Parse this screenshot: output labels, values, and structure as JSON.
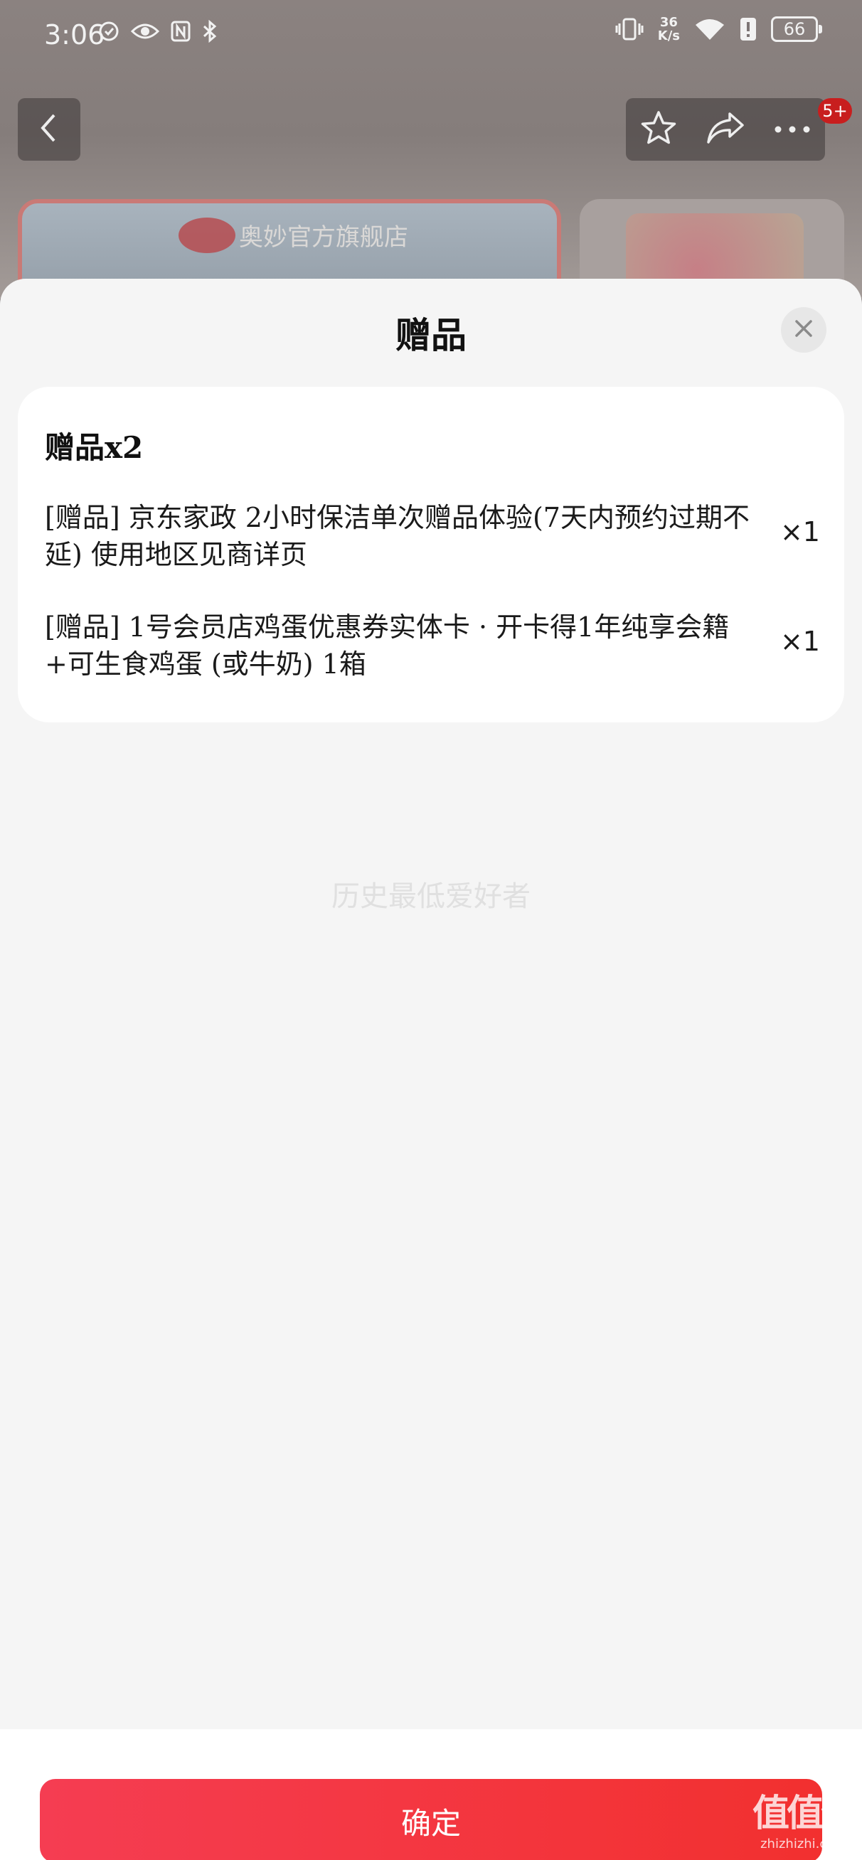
{
  "status_bar": {
    "time": "3:06",
    "net_speed_value": "36",
    "net_speed_unit": "K/s",
    "battery": "66"
  },
  "nav": {
    "cart_badge": "5+"
  },
  "background_banner": {
    "store_name": "奥妙官方旗舰店"
  },
  "sheet": {
    "title": "赠品",
    "gift_heading": "赠品x2",
    "items": [
      {
        "name": "[赠品] 京东家政 2小时保洁单次赠品体验(7天内预约过期不延) 使用地区见商详页",
        "qty": "×1"
      },
      {
        "name": "[赠品] 1号会员店鸡蛋优惠券实体卡 · 开卡得1年纯享会籍+可生食鸡蛋 (或牛奶) 1箱",
        "qty": "×1"
      }
    ],
    "watermark": "历史最低爱好者",
    "confirm_label": "确定"
  },
  "corner_logo": {
    "mark": "值值值",
    "site": "zhizhizhi.com"
  },
  "icons": {
    "back": "chevron-left-icon",
    "favorite": "star-icon",
    "share": "share-icon",
    "more": "more-icon",
    "close": "close-icon"
  }
}
